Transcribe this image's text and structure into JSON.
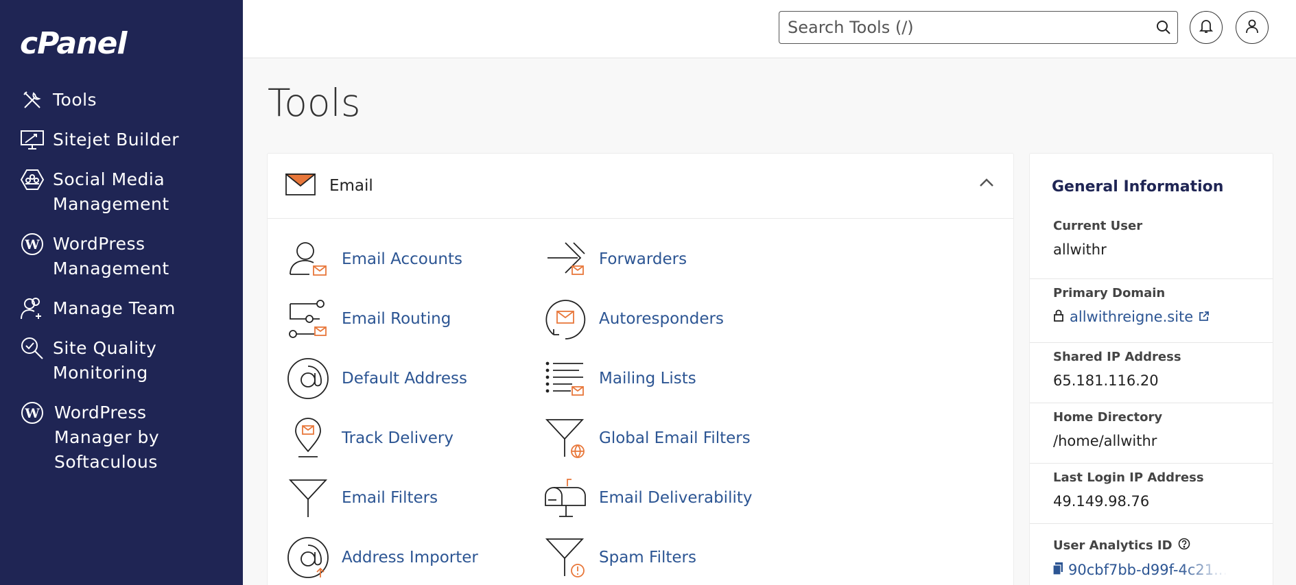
{
  "brand": {
    "logo_text": "cPanel"
  },
  "sidebar": {
    "items": [
      {
        "label": "Tools",
        "icon": "tools-icon"
      },
      {
        "label": "Sitejet Builder",
        "icon": "sitejet-icon"
      },
      {
        "label": "Social Media\nManagement",
        "icon": "social-media-icon"
      },
      {
        "label": "WordPress\nManagement",
        "icon": "wordpress-icon"
      },
      {
        "label": "Manage Team",
        "icon": "manage-team-icon"
      },
      {
        "label": "Site Quality\nMonitoring",
        "icon": "site-quality-icon"
      },
      {
        "label": "WordPress\nManager by\nSoftaculous",
        "icon": "wordpress-icon"
      }
    ]
  },
  "header": {
    "search_placeholder": "Search Tools (/)"
  },
  "page": {
    "title": "Tools"
  },
  "email_panel": {
    "title": "Email",
    "tools": [
      {
        "label": "Email Accounts",
        "icon": "email-accounts-icon"
      },
      {
        "label": "Forwarders",
        "icon": "forwarders-icon"
      },
      {
        "label": "Email Routing",
        "icon": "email-routing-icon"
      },
      {
        "label": "Autoresponders",
        "icon": "autoresponders-icon"
      },
      {
        "label": "Default Address",
        "icon": "default-address-icon"
      },
      {
        "label": "Mailing Lists",
        "icon": "mailing-lists-icon"
      },
      {
        "label": "Track Delivery",
        "icon": "track-delivery-icon"
      },
      {
        "label": "Global Email Filters",
        "icon": "global-email-filters-icon"
      },
      {
        "label": "Email Filters",
        "icon": "email-filters-icon"
      },
      {
        "label": "Email Deliverability",
        "icon": "email-deliverability-icon"
      },
      {
        "label": "Address Importer",
        "icon": "address-importer-icon"
      },
      {
        "label": "Spam Filters",
        "icon": "spam-filters-icon"
      }
    ]
  },
  "general_info": {
    "title": "General Information",
    "current_user_label": "Current User",
    "current_user": "allwithr",
    "primary_domain_label": "Primary Domain",
    "primary_domain": "allwithreigne.site",
    "shared_ip_label": "Shared IP Address",
    "shared_ip": "65.181.116.20",
    "home_dir_label": "Home Directory",
    "home_dir": "/home/allwithr",
    "last_login_label": "Last Login IP Address",
    "last_login": "49.149.98.76",
    "analytics_label": "User Analytics ID",
    "analytics_id": "90cbf7bb-d99f-4c21..."
  },
  "colors": {
    "sidebar_bg": "#1f2554",
    "accent_orange": "#e8773a",
    "link_blue": "#2c5593"
  }
}
